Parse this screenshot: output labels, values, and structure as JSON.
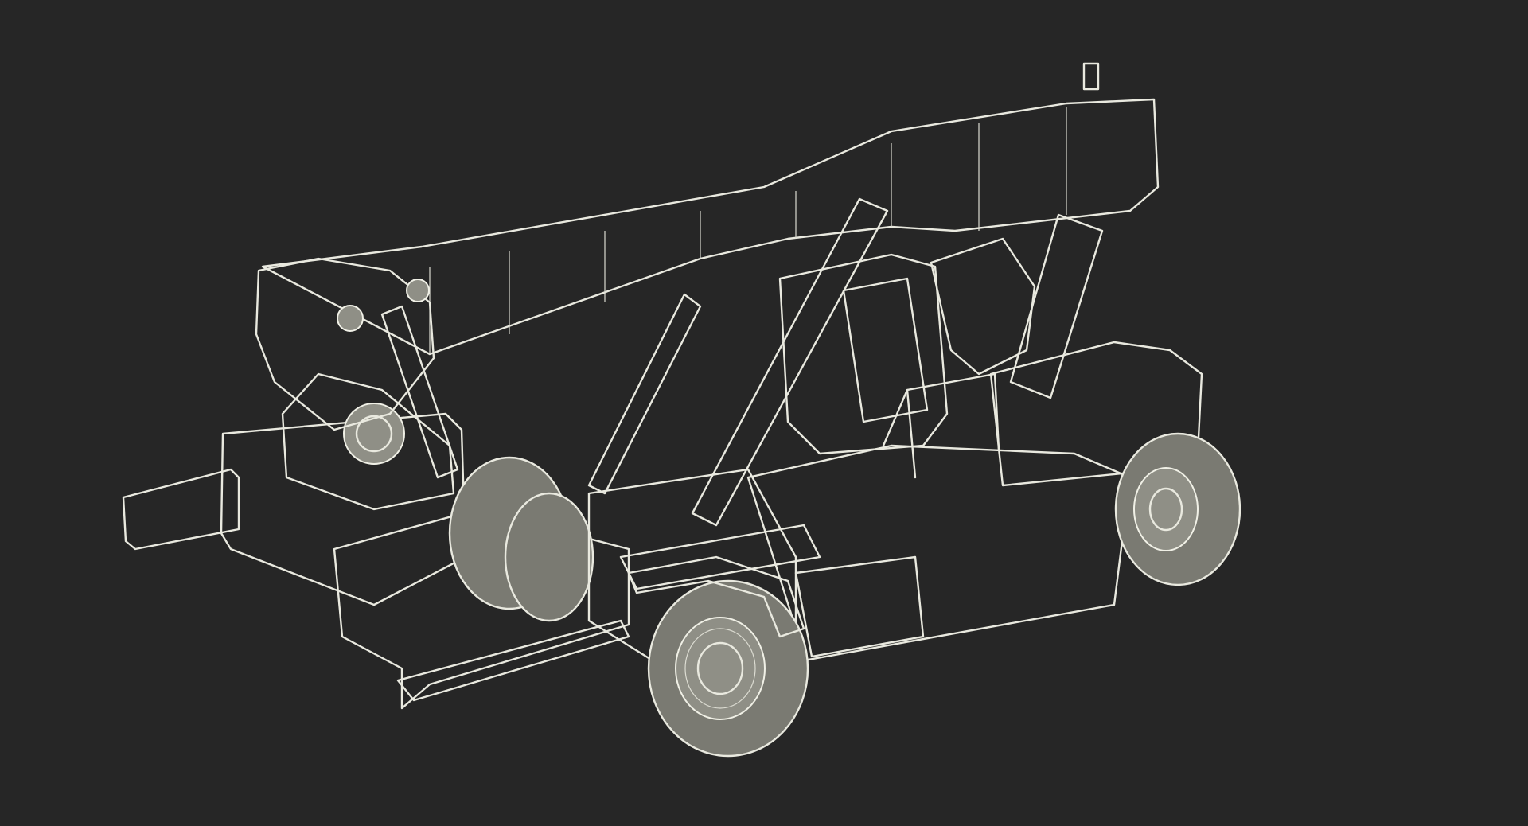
{
  "scene": {
    "subject": "reach-stacker-crane",
    "render_style": "wireframe",
    "colors": {
      "background": "#262626",
      "mesh_fill": "#86867d",
      "wire": "#e9e9df"
    }
  }
}
